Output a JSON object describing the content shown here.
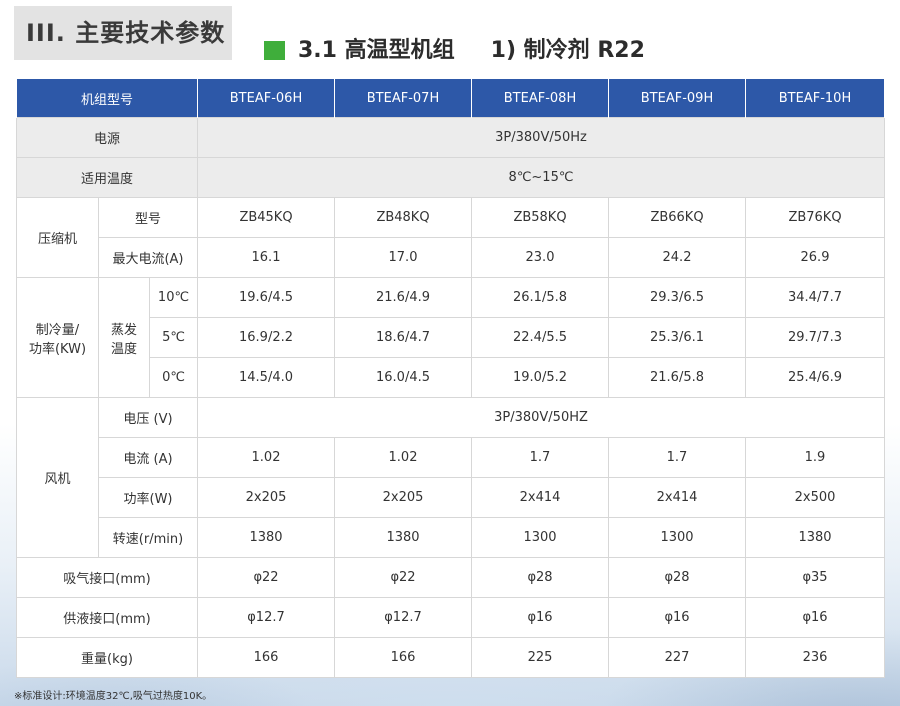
{
  "section_title": "III. 主要技术参数",
  "subtitle": {
    "part1": "3.1 高温型机组",
    "part2": "1) 制冷剂 R22"
  },
  "header": {
    "label": "机组型号",
    "models": [
      "BTEAF-06H",
      "BTEAF-07H",
      "BTEAF-08H",
      "BTEAF-09H",
      "BTEAF-10H"
    ]
  },
  "power": {
    "label": "电源",
    "value": "3P/380V/50Hz"
  },
  "temp_range": {
    "label": "适用温度",
    "value": "8℃~15℃"
  },
  "compressor": {
    "label": "压缩机",
    "model_label": "型号",
    "models": [
      "ZB45KQ",
      "ZB48KQ",
      "ZB58KQ",
      "ZB66KQ",
      "ZB76KQ"
    ],
    "current_label": "最大电流(A)",
    "currents": [
      "16.1",
      "17.0",
      "23.0",
      "24.2",
      "26.9"
    ]
  },
  "cooling": {
    "label": "制冷量/\n功率(KW)",
    "evap_label": "蒸发\n温度",
    "rows": [
      {
        "temp": "10℃",
        "values": [
          "19.6/4.5",
          "21.6/4.9",
          "26.1/5.8",
          "29.3/6.5",
          "34.4/7.7"
        ]
      },
      {
        "temp": "5℃",
        "values": [
          "16.9/2.2",
          "18.6/4.7",
          "22.4/5.5",
          "25.3/6.1",
          "29.7/7.3"
        ]
      },
      {
        "temp": "0℃",
        "values": [
          "14.5/4.0",
          "16.0/4.5",
          "19.0/5.2",
          "21.6/5.8",
          "25.4/6.9"
        ]
      }
    ]
  },
  "fan": {
    "label": "风机",
    "voltage_label": "电压 (V)",
    "voltage": "3P/380V/50HZ",
    "current_label": "电流 (A)",
    "currents": [
      "1.02",
      "1.02",
      "1.7",
      "1.7",
      "1.9"
    ],
    "power_label": "功率(W)",
    "powers": [
      "2x205",
      "2x205",
      "2x414",
      "2x414",
      "2x500"
    ],
    "speed_label": "转速(r/min)",
    "speeds": [
      "1380",
      "1380",
      "1300",
      "1300",
      "1380"
    ]
  },
  "suction": {
    "label": "吸气接口(mm)",
    "values": [
      "φ22",
      "φ22",
      "φ28",
      "φ28",
      "φ35"
    ]
  },
  "liquid": {
    "label": "供液接口(mm)",
    "values": [
      "φ12.7",
      "φ12.7",
      "φ16",
      "φ16",
      "φ16"
    ]
  },
  "weight": {
    "label": "重量(kg)",
    "values": [
      "166",
      "166",
      "225",
      "227",
      "236"
    ]
  },
  "footnote": "※标准设计:环境温度32℃,吸气过热度10K。"
}
